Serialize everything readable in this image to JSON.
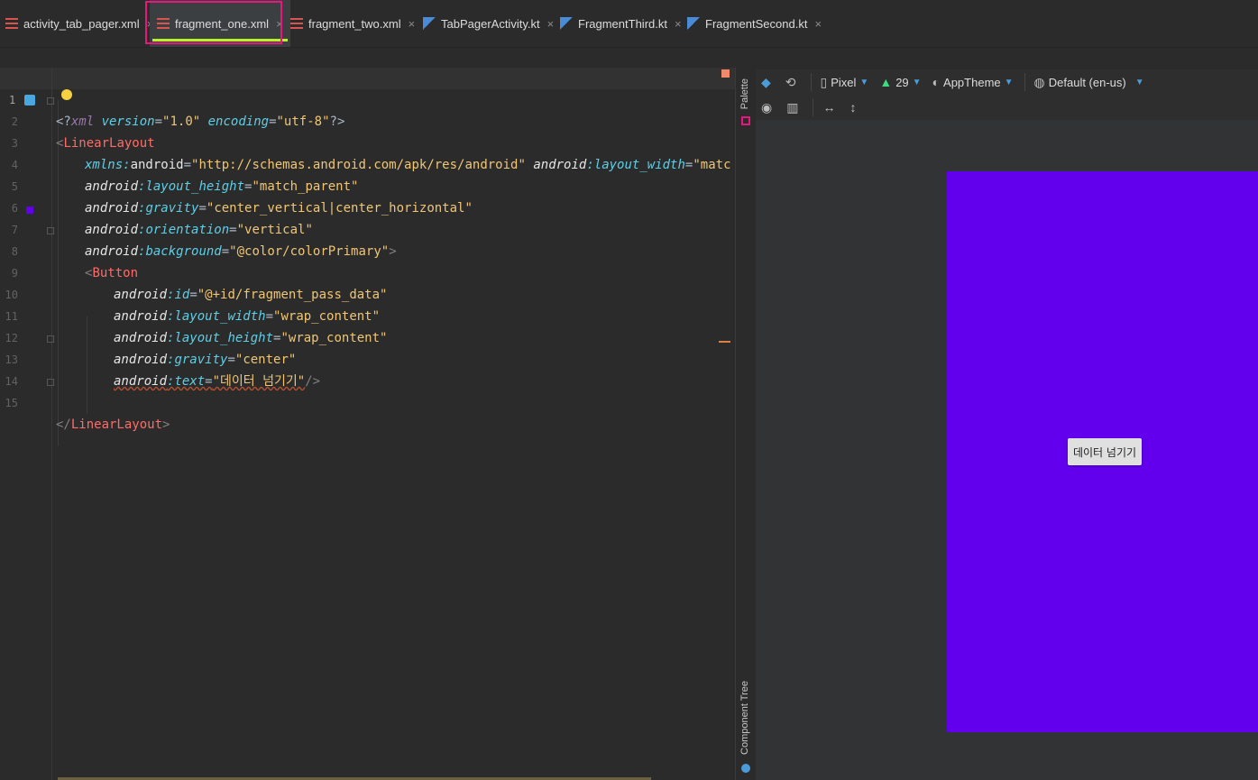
{
  "tabs": [
    {
      "label": "activity_tab_pager.xml",
      "type": "xml"
    },
    {
      "label": "fragment_one.xml",
      "type": "xml",
      "active": true
    },
    {
      "label": "fragment_two.xml",
      "type": "xml"
    },
    {
      "label": "TabPagerActivity.kt",
      "type": "kotlin"
    },
    {
      "label": "FragmentThird.kt",
      "type": "kotlin"
    },
    {
      "label": "FragmentSecond.kt",
      "type": "kotlin"
    }
  ],
  "close_glyph": "×",
  "editor": {
    "line_numbers": [
      "1",
      "2",
      "3",
      "4",
      "5",
      "6",
      "7",
      "8",
      "9",
      "10",
      "11",
      "12",
      "13",
      "14",
      "15"
    ],
    "lines": {
      "l1": {
        "a": "<?",
        "b": "xml ",
        "c": "version",
        "d": "=",
        "e": "\"1.0\"",
        "f": " ",
        "g": "encoding",
        "h": "=",
        "i": "\"utf-8\"",
        "j": "?>"
      },
      "l2": {
        "a": "<",
        "b": "LinearLayout"
      },
      "l3": {
        "a": "xmlns:",
        "b": "android",
        "c": "=",
        "d": "\"http://schemas.android.com/apk/res/android\"",
        "e": " android",
        "f": ":layout_width",
        "g": "=",
        "h": "\"match_par"
      },
      "l4": {
        "a": "android",
        "b": ":layout_height",
        "c": "=",
        "d": "\"match_parent\""
      },
      "l5": {
        "a": "android",
        "b": ":gravity",
        "c": "=",
        "d": "\"center_vertical|center_horizontal\""
      },
      "l6": {
        "a": "android",
        "b": ":orientation",
        "c": "=",
        "d": "\"vertical\""
      },
      "l7": {
        "a": "android",
        "b": ":background",
        "c": "=",
        "d": "\"@color/colorPrimary\"",
        "e": ">"
      },
      "l8": {
        "a": "<",
        "b": "Button"
      },
      "l9": {
        "a": "android",
        "b": ":id",
        "c": "=",
        "d": "\"@+id/fragment_pass_data\""
      },
      "l10": {
        "a": "android",
        "b": ":layout_width",
        "c": "=",
        "d": "\"wrap_content\""
      },
      "l11": {
        "a": "android",
        "b": ":layout_height",
        "c": "=",
        "d": "\"wrap_content\""
      },
      "l12": {
        "a": "android",
        "b": ":gravity",
        "c": "=",
        "d": "\"center\""
      },
      "l13": {
        "a": "android",
        "b": ":text",
        "c": "=",
        "d": "\"데이터 넘기기\"",
        "e": "/>"
      },
      "l15": {
        "a": "</",
        "b": "LinearLayout",
        "c": ">"
      }
    }
  },
  "side_strip": {
    "palette": "Palette",
    "component_tree": "Component Tree"
  },
  "design_toolbar": {
    "device": "Pixel",
    "api": "29",
    "theme": "AppTheme",
    "locale": "Default (en-us)"
  },
  "preview": {
    "button_text": "데이터 넘기기",
    "background_color": "#6200ee"
  },
  "colors": {
    "active_tab_underline": "#b8f02c",
    "tab_highlight": "#e8177d"
  }
}
